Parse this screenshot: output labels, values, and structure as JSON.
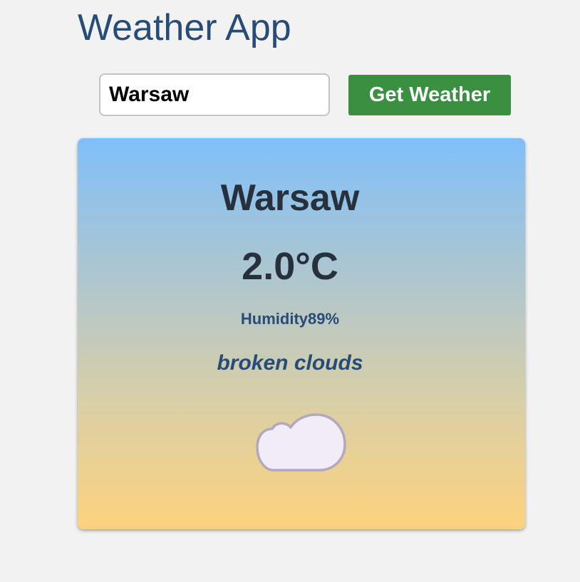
{
  "header": {
    "title": "Weather App"
  },
  "search": {
    "value": "Warsaw",
    "button_label": "Get Weather"
  },
  "weather": {
    "city": "Warsaw",
    "temperature": "2.0°C",
    "humidity_label": "Humidity",
    "humidity_value": "89%",
    "description": "broken clouds",
    "icon": "cloud-icon"
  },
  "colors": {
    "title": "#274c77",
    "button": "#3a8f40",
    "card_gradient_top": "#80bff9",
    "card_gradient_bottom": "#fdd27d",
    "cloud_fill": "#f2ecf8",
    "cloud_stroke": "#b3a8bd"
  }
}
